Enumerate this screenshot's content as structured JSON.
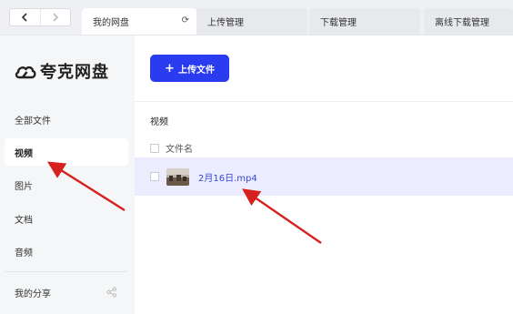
{
  "tabs": [
    {
      "label": "我的网盘",
      "active": true
    },
    {
      "label": "上传管理",
      "active": false
    },
    {
      "label": "下载管理",
      "active": false
    },
    {
      "label": "离线下载管理",
      "active": false
    }
  ],
  "logo": {
    "text": "夸克网盘"
  },
  "sidebar": {
    "items": [
      {
        "label": "全部文件"
      },
      {
        "label": "视频",
        "active": true
      },
      {
        "label": "图片"
      },
      {
        "label": "文档"
      },
      {
        "label": "音频"
      },
      {
        "label": "我的分享"
      }
    ]
  },
  "main": {
    "upload_label": "上传文件",
    "section_title": "视频",
    "column_header": "文件名",
    "files": [
      {
        "name": "2月16日.mp4"
      }
    ]
  },
  "colors": {
    "accent": "#2b3bf0",
    "annotation": "#d72020",
    "row_highlight": "#ebedfe"
  }
}
